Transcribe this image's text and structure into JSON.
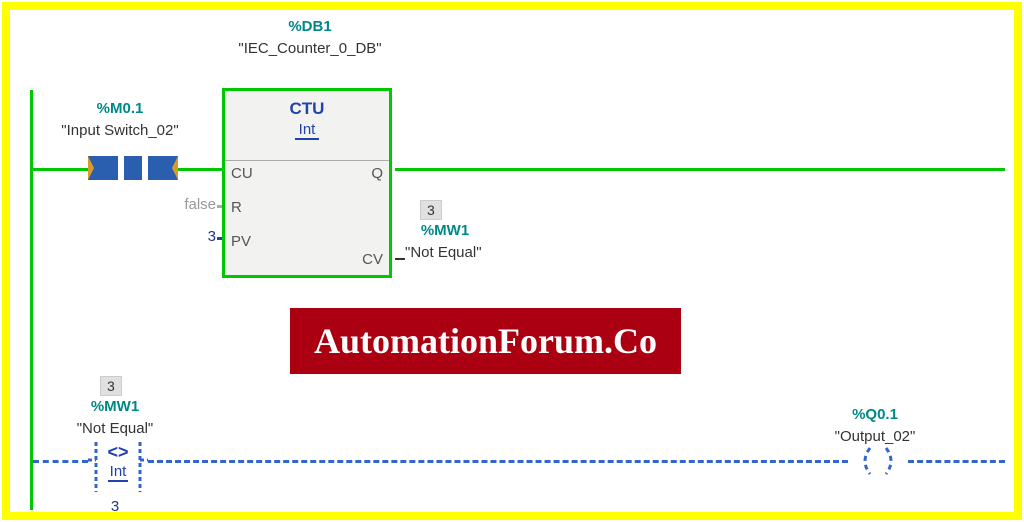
{
  "rung1": {
    "input": {
      "address": "%M0.1",
      "name": "\"Input Switch_02\"",
      "energized": true
    },
    "counter": {
      "db_address": "%DB1",
      "db_name": "\"IEC_Counter_0_DB\"",
      "block_type": "CTU",
      "data_type": "Int",
      "pins": {
        "CU": "CU",
        "R": "R",
        "PV": "PV",
        "Q": "Q",
        "CV": "CV"
      },
      "r_value": "false",
      "pv_value": "3",
      "cv_value_box": "3",
      "cv_address": "%MW1",
      "cv_name": "\"Not Equal\""
    }
  },
  "rung2": {
    "compare": {
      "value_box": "3",
      "address": "%MW1",
      "name": "\"Not Equal\"",
      "operator": "<>",
      "data_type": "Int",
      "operand2": "3"
    },
    "output": {
      "address": "%Q0.1",
      "name": "\"Output_02\""
    }
  },
  "watermark": "AutomationForum.Co"
}
